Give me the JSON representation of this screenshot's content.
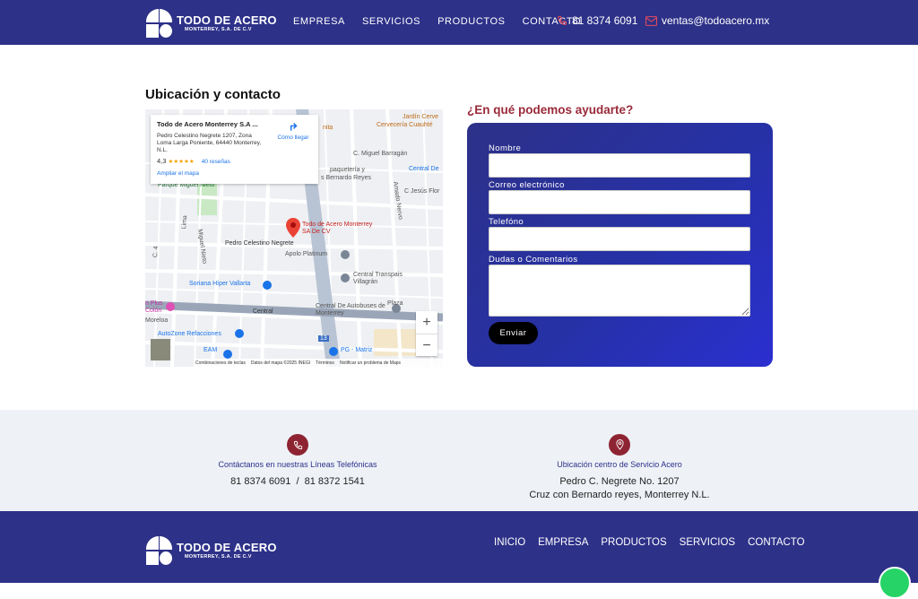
{
  "brand": {
    "name": "TODO DE ACERO",
    "tagline": "MONTERREY, S.A. DE C.V"
  },
  "nav": [
    "EMPRESA",
    "SERVICIOS",
    "PRODUCTOS",
    "CONTACTO"
  ],
  "header_contact": {
    "phone": "81 8374 6091",
    "email": "ventas@todoacero.mx"
  },
  "section_title": "Ubicación y contacto",
  "map": {
    "place_name": "Todo de Acero Monterrey S.A ...",
    "address": "Pedro Celestino Negrete 1207, Zona Loma Larga Poniente, 64440 Monterrey, N.L.",
    "rating": "4,3",
    "stars": "★★★★★",
    "reviews": "40 reseñas",
    "directions": "Cómo llegar",
    "enlarge": "Ampliar el mapa",
    "pin_label": "Todo de Acero Monterrey SA De CV",
    "labels": [
      "Jardín Cerve",
      "Cervecería Cuauhté",
      "C. Miguel Barragán",
      "paquetería y",
      "s Bernardo Reyes",
      "Central De",
      "C Jesús Flor",
      "Parque Miguel Nieto",
      "Pedro Celestino Negrete",
      "Apolo Platinum",
      "Central Transpais Villagrán",
      "Soriana Híper Vallarta",
      "Central",
      "Central De Autobuses de Monterrey",
      "n Plus Colón",
      "AutoZone Refacciones",
      "EAM",
      "PG - Matriz",
      "Miguel Nieto",
      "Lima",
      "Amado Nervo",
      "Plaza",
      "C. 4",
      "Moreloa",
      "13",
      "nita"
    ],
    "zoom_in": "+",
    "zoom_out": "−",
    "footer": [
      "Combinaciones de teclas",
      "Datos del mapa ©2025 INEGI",
      "Términos",
      "Notificar un problema de Maps"
    ]
  },
  "form": {
    "heading": "¿En qué podemos ayudarte?",
    "fields": [
      {
        "label": "Nombre"
      },
      {
        "label": "Correo electrónico"
      },
      {
        "label": "Telefóno"
      },
      {
        "label": "Dudas o Comentarios"
      }
    ],
    "submit": "Enviar"
  },
  "info": {
    "phones": {
      "caption": "Contáctanos en nuestras Líneas Telefónicas",
      "value": "81 8374 6091  /  81 8372 1541"
    },
    "location": {
      "caption": "Ubicación centro de Servicio Acero",
      "line1": "Pedro C. Negrete No. 1207",
      "line2": "Cruz con Bernardo reyes, Monterrey N.L."
    }
  },
  "footer_nav": [
    "INICIO",
    "EMPRESA",
    "PRODUCTOS",
    "SERVICIOS",
    "CONTACTO"
  ],
  "colors": {
    "primary": "#2d3188",
    "accent": "#9a2a3a",
    "whatsapp": "#25d366"
  }
}
